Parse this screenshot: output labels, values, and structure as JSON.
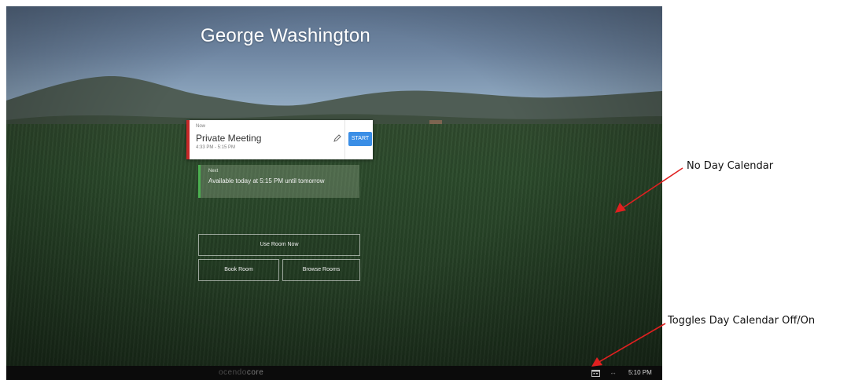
{
  "screen": {
    "room_name": "George Washington",
    "current": {
      "label": "Now",
      "title": "Private Meeting",
      "time": "4:33 PM - 5:15 PM",
      "start_label": "START",
      "accent": "#c62828",
      "start_color": "#3a8ee6"
    },
    "next": {
      "label": "Next",
      "text": "Available today at 5:15 PM until tomorrow",
      "accent": "#4caf50"
    },
    "buttons": {
      "use_room": "Use Room Now",
      "book_room": "Book Room",
      "browse_rooms": "Browse Rooms"
    },
    "bottom_bar": {
      "brand_prefix": "ocendo",
      "brand_suffix": "core",
      "clock": "5:10 PM",
      "icons": [
        "calendar-toggle-icon",
        "double-arrow-icon"
      ]
    }
  },
  "annotations": {
    "no_day_calendar": "No Day Calendar",
    "toggle_label": "Toggles Day Calendar Off/On",
    "arrow_color": "#e02020"
  }
}
